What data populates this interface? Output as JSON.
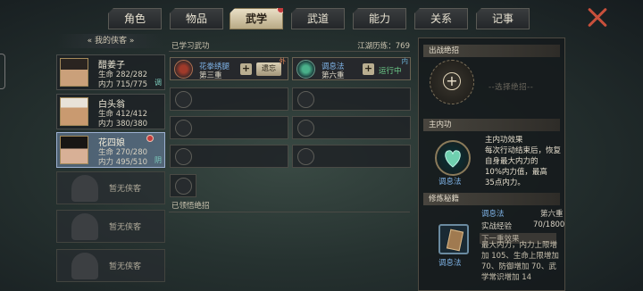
{
  "tabs": [
    {
      "label": "角色"
    },
    {
      "label": "物品"
    },
    {
      "label": "武学"
    },
    {
      "label": "武道"
    },
    {
      "label": "能力"
    },
    {
      "label": "关系"
    },
    {
      "label": "记事"
    }
  ],
  "active_tab": "武学",
  "sidebar": {
    "header": "我的侠客",
    "characters": [
      {
        "name": "醋姜子",
        "hp_label": "生命",
        "hp": "282/282",
        "mp_label": "内力",
        "mp": "715/775",
        "tag": "调"
      },
      {
        "name": "白头翁",
        "hp_label": "生命",
        "hp": "412/412",
        "mp_label": "内力",
        "mp": "380/380",
        "tag": ""
      },
      {
        "name": "花四娘",
        "hp_label": "生命",
        "hp": "270/280",
        "mp_label": "内力",
        "mp": "495/510",
        "tag": "阴"
      }
    ],
    "empty_label": "暂无侠客"
  },
  "middle": {
    "learned_title": "已学习武功",
    "jianghu_label": "江湖历练：769",
    "skills": [
      {
        "name": "花拳绣腿",
        "level": "第三重",
        "button": "遗忘",
        "flag": "外",
        "kind": "out"
      },
      {
        "name": "调息法",
        "level": "第六重",
        "status": "运行中",
        "flag": "内",
        "kind": "in"
      }
    ],
    "ultimate_title": "已领悟绝招"
  },
  "right": {
    "battle_title": "出战绝招",
    "choose_text": "--选择绝招--",
    "main_neigong_title": "主内功",
    "effect_title": "主内功效果",
    "effect_lines": [
      "每次行动结束后，恢复",
      "自身最大内力的",
      "10%内力值，最高",
      "35点内力。"
    ],
    "neigong_name": "调息法",
    "cultivate_title": "修炼秘籍",
    "book_name": "调息法",
    "book_level": "第六重",
    "exp_label": "实战经验",
    "exp_value": "70/1800",
    "next_label": "下一重效果",
    "next_lines": [
      "最大内力，内力上限增",
      "加 105、生命上限增加",
      "70、防御增加 70、武",
      "学常识增加 14"
    ],
    "book_caption": "调息法"
  },
  "colors": {
    "accent_blue": "#7fb4e8",
    "run_green": "#6fd08c",
    "selected_row": "#7088ac"
  }
}
